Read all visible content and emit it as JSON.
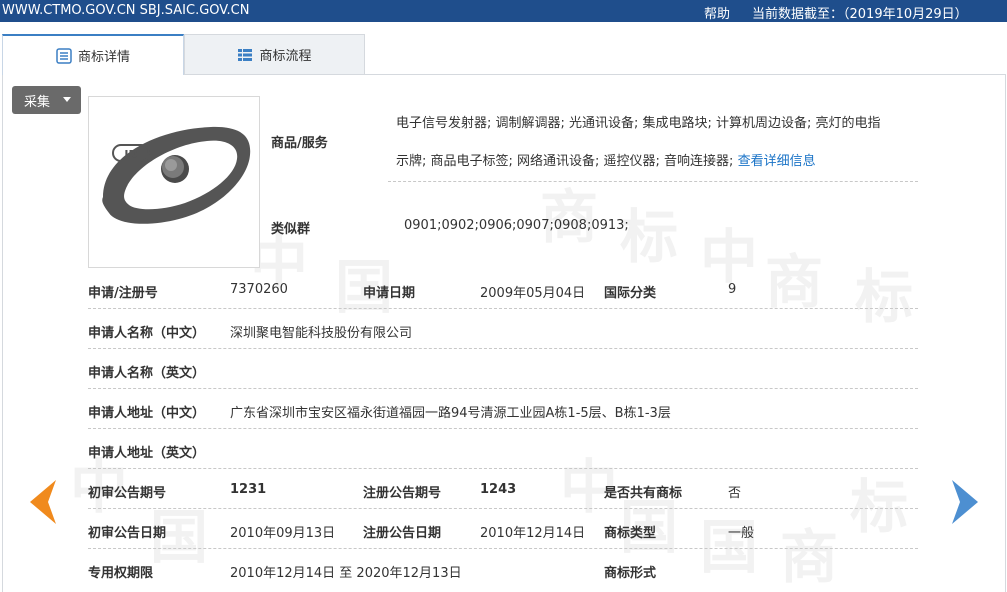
{
  "topbar": {
    "site": "WWW.CTMO.GOV.CN SBJ.SAIC.GOV.CN",
    "help": "帮助",
    "as_of": "当前数据截至：（2019年10月29日）"
  },
  "tabs": [
    {
      "label": "商标详情",
      "icon": "list-icon"
    },
    {
      "label": "商标流程",
      "icon": "grid-list-icon"
    }
  ],
  "collect_button": "采集",
  "watermark_chars": [
    "中",
    "国",
    "商",
    "标"
  ],
  "goods_services": {
    "label": "商品/服务",
    "line1": "电子信号发射器; 调制解调器; 光通讯设备; 集成电路块; 计算机周边设备; 亮灯的电指",
    "line2": "示牌; 商品电子标签; 网络通讯设备; 遥控仪器; 音响连接器;",
    "more_link": "查看详细信息"
  },
  "similar_group": {
    "label": "类似群",
    "value": "0901;0902;0906;0907;0908;0913;"
  },
  "fields": {
    "reg_no_label": "申请/注册号",
    "reg_no": "7370260",
    "apply_date_label": "申请日期",
    "apply_date": "2009年05月04日",
    "intl_class_label": "国际分类",
    "intl_class": "9",
    "applicant_cn_label": "申请人名称（中文）",
    "applicant_cn": "深圳聚电智能科技股份有限公司",
    "applicant_en_label": "申请人名称（英文）",
    "applicant_en": "",
    "address_cn_label": "申请人地址（中文）",
    "address_cn": "广东省深圳市宝安区福永街道福园一路94号清源工业园A栋1-5层、B栋1-3层",
    "address_en_label": "申请人地址（英文）",
    "address_en": "",
    "prelim_issue_label": "初审公告期号",
    "prelim_issue": "1231",
    "reg_issue_label": "注册公告期号",
    "reg_issue": "1243",
    "shared_label": "是否共有商标",
    "shared": "否",
    "prelim_date_label": "初审公告日期",
    "prelim_date": "2010年09月13日",
    "reg_date_label": "注册公告日期",
    "reg_date": "2010年12月14日",
    "tm_type_label": "商标类型",
    "tm_type": "一般",
    "term_label": "专用权期限",
    "term": "2010年12月14日 至 2020年12月13日",
    "tm_form_label": "商标形式",
    "tm_form": ""
  },
  "colors": {
    "topbar": "#1f4e8c",
    "link": "#1a73c7",
    "arrow_left": "#f08a1d",
    "arrow_right": "#4d8fd1"
  }
}
